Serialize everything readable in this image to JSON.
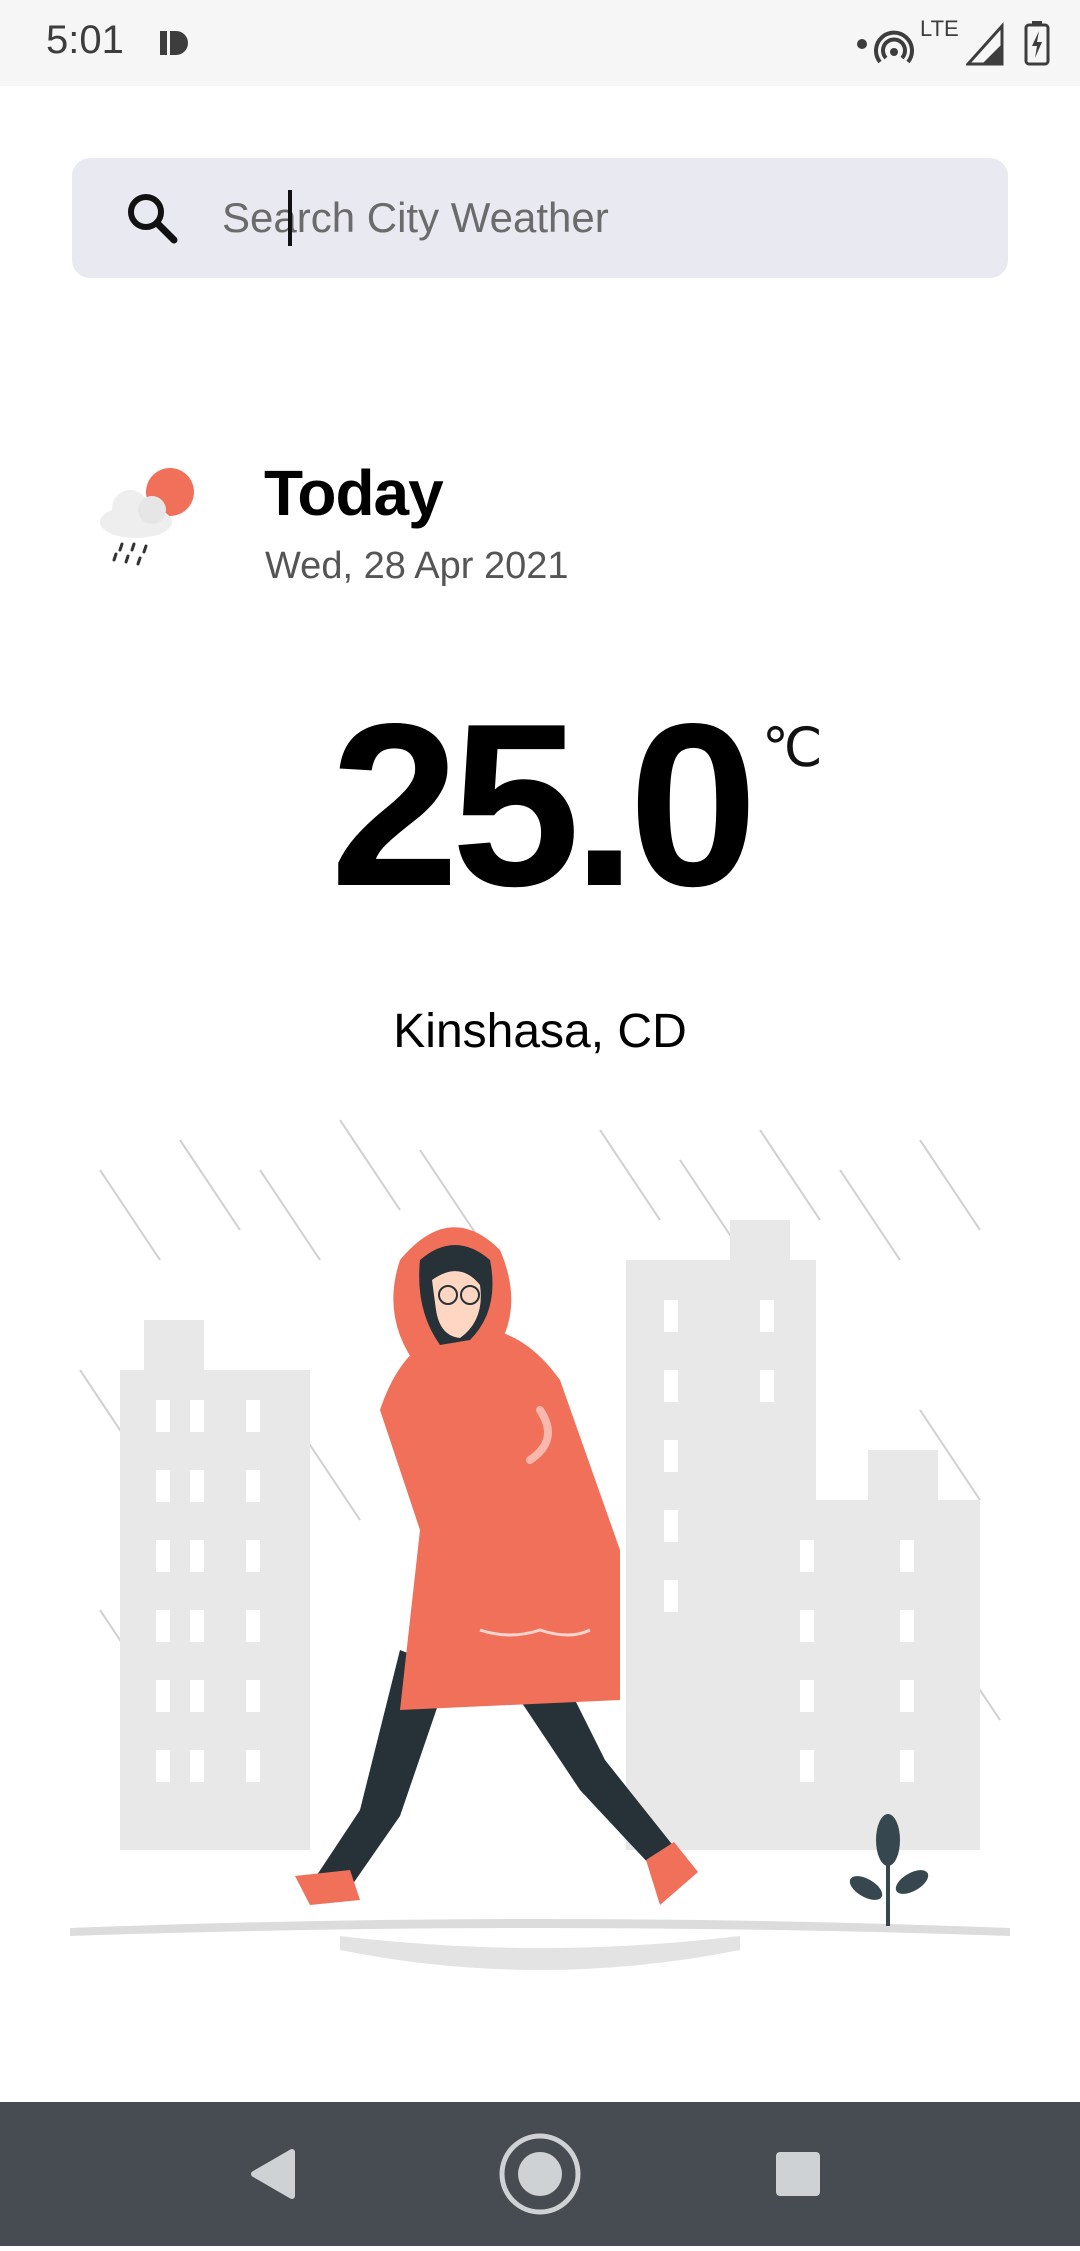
{
  "status_bar": {
    "time": "5:01",
    "network": "LTE",
    "icons": [
      "data-saver-icon",
      "hotspot-icon",
      "signal-icon",
      "battery-charging-icon"
    ]
  },
  "search": {
    "placeholder": "Search City Weather",
    "value": "",
    "icon": "search-icon"
  },
  "today": {
    "title": "Today",
    "date": "Wed, 28 Apr 2021",
    "icon": "rain-cloud-sun-icon"
  },
  "weather": {
    "temperature": "25.0",
    "unit": "℃",
    "location": "Kinshasa, CD"
  },
  "illustration": {
    "subject": "woman-in-raincoat-walking-in-rain"
  },
  "nav": {
    "back": "back-icon",
    "home": "home-icon",
    "recents": "recents-icon"
  },
  "colors": {
    "accent": "#f0705a",
    "search_bg": "#e8e9f1",
    "nav_bg": "#464c52"
  }
}
